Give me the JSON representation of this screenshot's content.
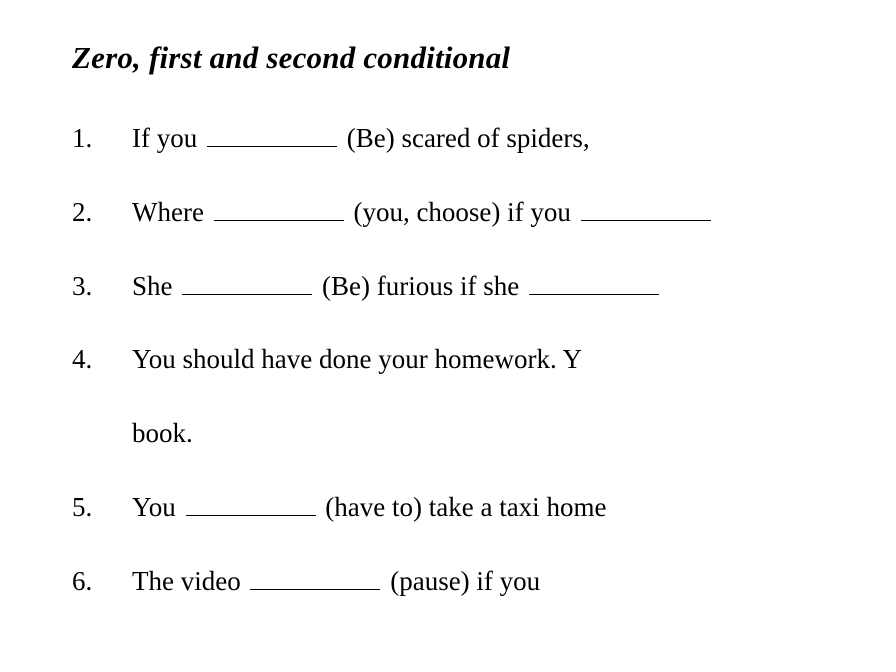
{
  "title": "Zero, first and second conditional",
  "items": {
    "q1": {
      "before": "If you",
      "hint1": "(Be) scared of spiders,"
    },
    "q2": {
      "before": "Where",
      "hint1": "(you, choose) if you"
    },
    "q3": {
      "before": "She",
      "hint1": "(Be) furious if she"
    },
    "q4": {
      "line1": "You should have done your homework. Y",
      "line2": "book."
    },
    "q5": {
      "before": "You",
      "hint1": "(have to) take a taxi home"
    },
    "q6": {
      "before": "The video",
      "hint1": "(pause) if you"
    }
  }
}
